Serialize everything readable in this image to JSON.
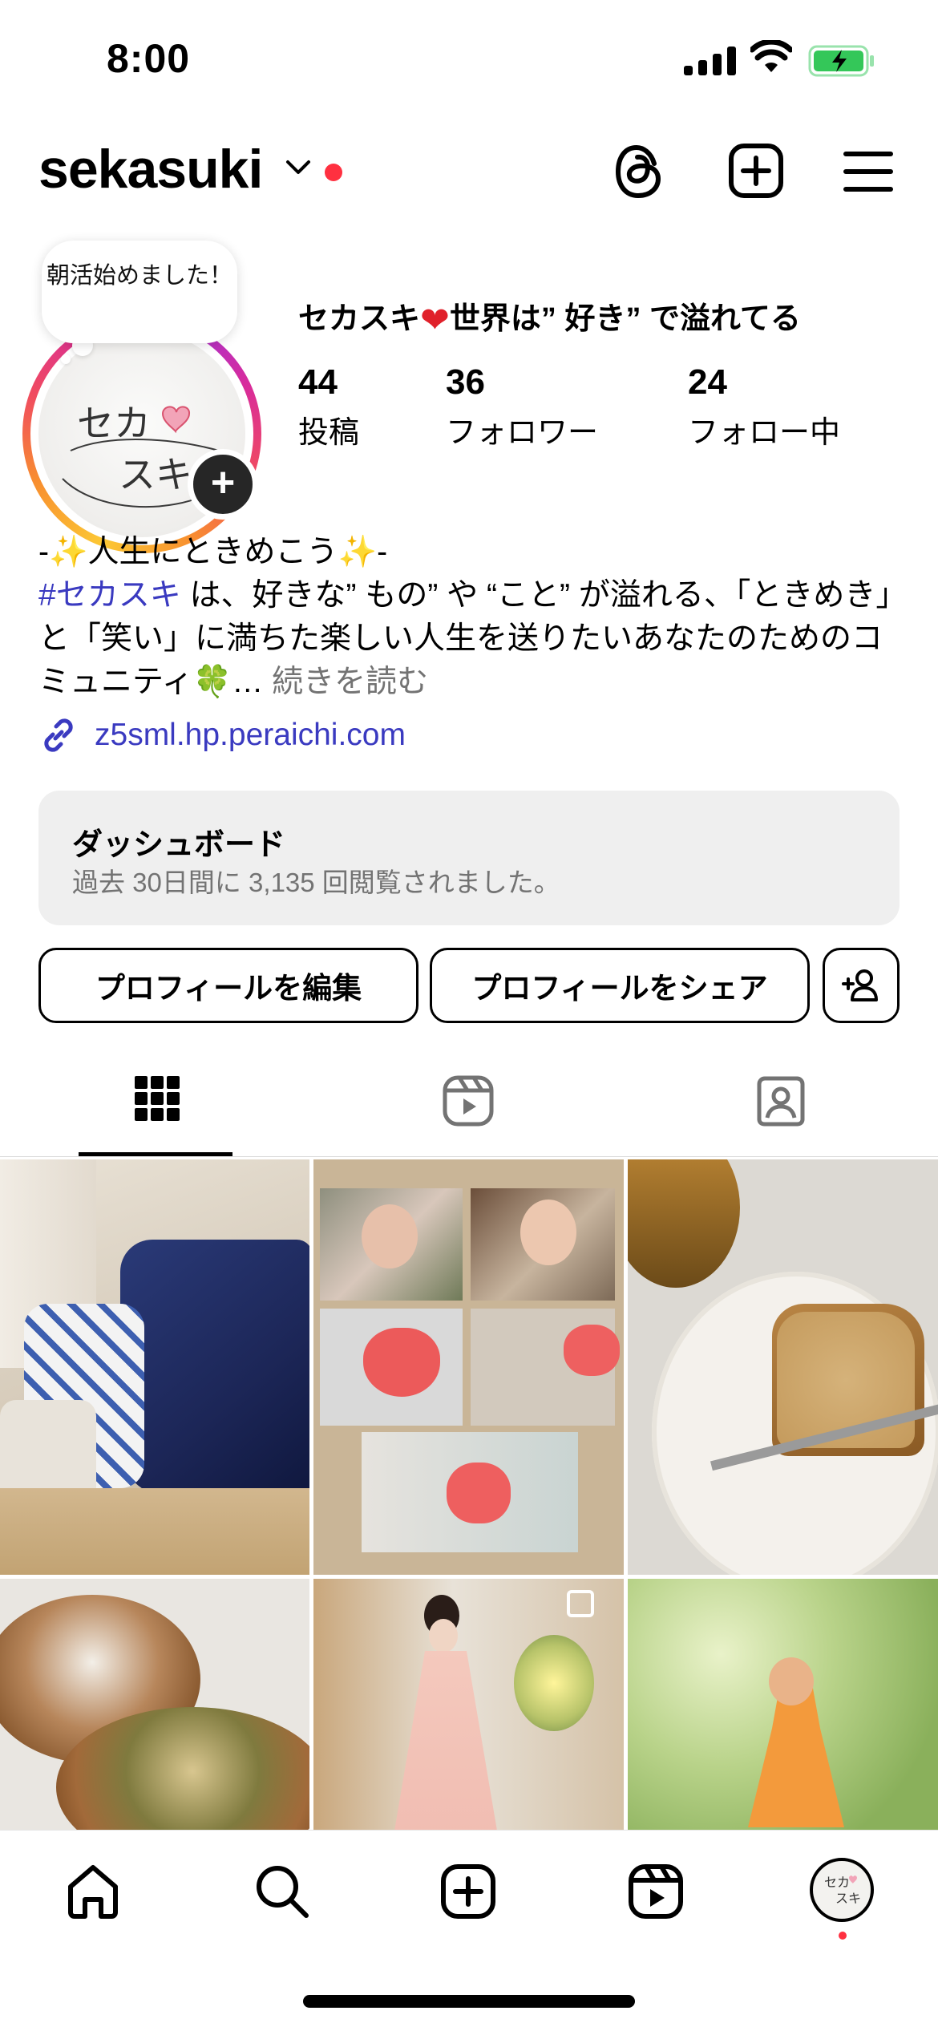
{
  "status_bar": {
    "time": "8:00"
  },
  "header": {
    "username": "sekasuki"
  },
  "note": {
    "text": "朝活始めました！"
  },
  "profile": {
    "name_before": "セカスキ",
    "name_after": "世界は” 好き” で溢れてる",
    "stats": [
      {
        "value": "44",
        "label": "投稿"
      },
      {
        "value": "36",
        "label": "フォロワー"
      },
      {
        "value": "24",
        "label": "フォロー中"
      }
    ]
  },
  "bio": {
    "line1": "-✨人生にときめこう✨-",
    "hashtag": "#セカスキ",
    "text": " は、好きな” もの” や “こと” が溢れる、「ときめき」と「笑い」に満ちた楽しい人生を送りたいあなたのためのコミュニティ🍀…",
    "more": " 続きを読む"
  },
  "link": {
    "url": "z5sml.hp.peraichi.com"
  },
  "dashboard": {
    "title": "ダッシュボード",
    "subtitle": "過去 30日間に 3,135 回閲覧されました。"
  },
  "buttons": {
    "edit": "プロフィールを編集",
    "share": "プロフィールをシェア"
  },
  "avatar_text": {
    "line1": "セカ",
    "line2": "スキ"
  },
  "colors": {
    "link": "#3a3ac0",
    "notification": "#ff3040",
    "battery": "#34c759",
    "muted": "#737373"
  },
  "icons": [
    "threads-icon",
    "create-post-icon",
    "menu-icon",
    "grid-icon",
    "reels-icon",
    "tagged-icon",
    "home-icon",
    "search-icon",
    "create-icon",
    "reels-nav-icon",
    "profile-avatar-icon"
  ]
}
